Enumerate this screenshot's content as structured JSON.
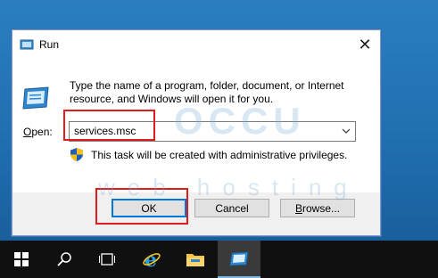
{
  "dialog": {
    "title": "Run",
    "close_symbol": "✕",
    "description": "Type the name of a program, folder, document, or Internet resource, and Windows will open it for you.",
    "open_label_accel": "O",
    "open_label_rest": "pen:",
    "open_value": "services.msc",
    "admin_note": "This task will be created with administrative privileges.",
    "buttons": {
      "ok": "OK",
      "cancel": "Cancel",
      "browse_pre": "",
      "browse_accel": "B",
      "browse_rest": "rowse..."
    }
  },
  "watermark": {
    "brand": "OCCU",
    "sub": "web hosting"
  },
  "taskbar": {
    "items": [
      {
        "name": "start-button",
        "icon": "windows-logo-icon"
      },
      {
        "name": "search-button",
        "icon": "search-icon"
      },
      {
        "name": "task-view-button",
        "icon": "task-view-icon"
      },
      {
        "name": "internet-explorer-button",
        "icon": "internet-explorer-icon"
      },
      {
        "name": "file-explorer-button",
        "icon": "folder-icon"
      },
      {
        "name": "run-taskbar-button",
        "icon": "run-icon",
        "active": true
      }
    ]
  },
  "colors": {
    "highlight": "#e11b1b",
    "accent": "#0078d7",
    "desktop": "#1f6eb0",
    "taskbar": "#101010"
  }
}
